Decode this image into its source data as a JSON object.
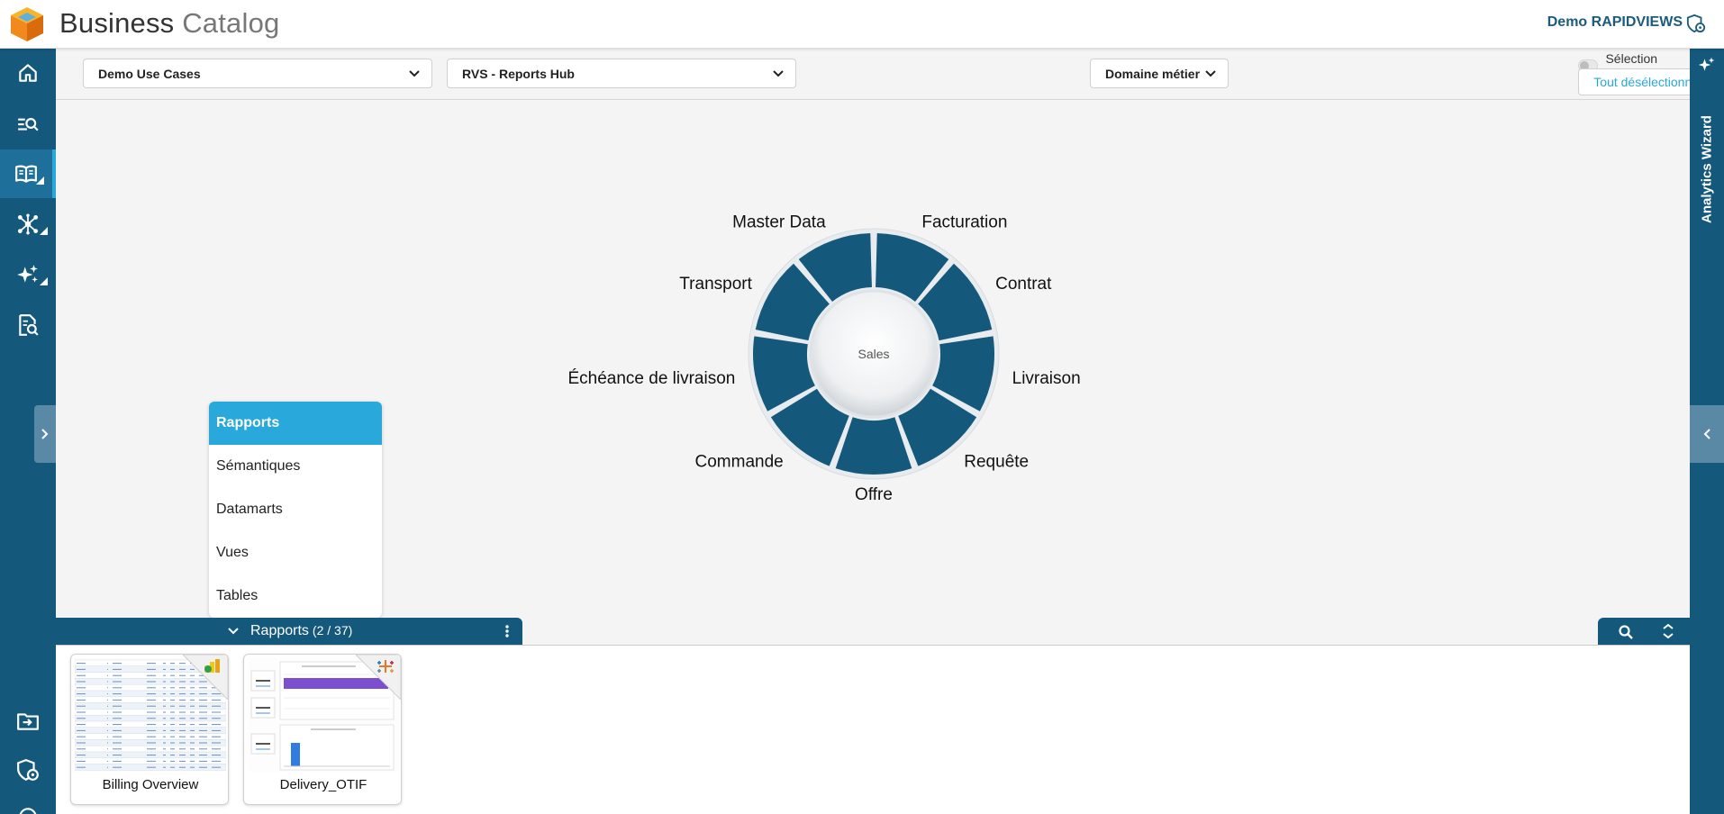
{
  "header": {
    "title_main": "Business",
    "title_light": "Catalog",
    "user_name": "Demo RAPIDVIEWS",
    "logo_icon": "cube-logo-icon",
    "user_icon": "user-shield-icon",
    "accent_color": "#14587c"
  },
  "sidebar": {
    "items": [
      {
        "icon": "home-icon",
        "active": false
      },
      {
        "icon": "search-list-icon",
        "active": false
      },
      {
        "icon": "open-book-icon",
        "active": true
      },
      {
        "icon": "network-icon",
        "active": false
      },
      {
        "icon": "sparkles-icon",
        "active": false
      },
      {
        "icon": "document-search-icon",
        "active": false
      },
      {
        "icon": "folder-import-icon",
        "active": false
      },
      {
        "icon": "user-shield-icon",
        "active": false
      },
      {
        "icon": "headset-icon",
        "active": false
      }
    ]
  },
  "rightbar": {
    "title": "Analytics Wizard"
  },
  "filters": {
    "use_case": "Demo Use Cases",
    "hub": "RVS - Reports Hub",
    "domain": "Domaine métier",
    "multi_select_label": "Sélection multiple",
    "deselect_label": "Tout désélectionner"
  },
  "wheel": {
    "center": "Sales",
    "segments": [
      "Facturation",
      "Contrat",
      "Livraison",
      "Requête",
      "Offre",
      "Commande",
      "Échéance de livraison",
      "Transport",
      "Master Data"
    ],
    "segment_color": "#14587c"
  },
  "type_menu": {
    "items": [
      "Rapports",
      "Sémantiques",
      "Datamarts",
      "Vues",
      "Tables"
    ],
    "active": "Rapports"
  },
  "panel": {
    "title": "Rapports",
    "count": "(2 / 37)"
  },
  "cards": [
    {
      "name": "Billing Overview",
      "tool_icon": "powerbi-report-icon"
    },
    {
      "name": "Delivery_OTIF",
      "tool_icon": "tableau-icon"
    }
  ]
}
